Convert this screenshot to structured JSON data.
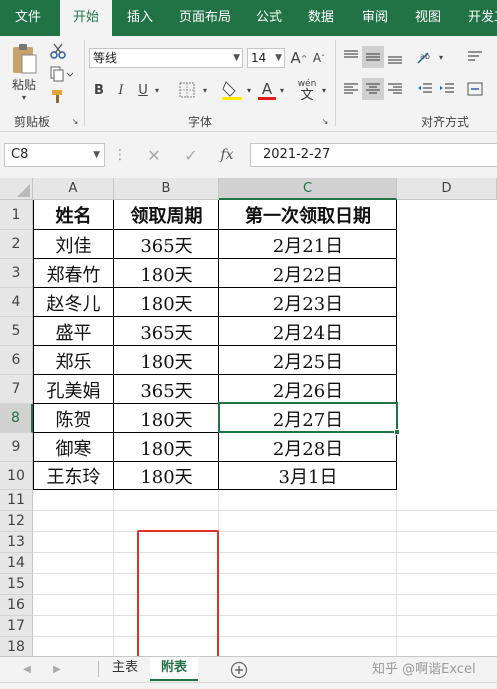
{
  "ribbon_tabs": [
    "文件",
    "开始",
    "插入",
    "页面布局",
    "公式",
    "数据",
    "审阅",
    "视图",
    "开发工具"
  ],
  "active_tab": "开始",
  "clipboard": {
    "paste_label": "粘贴",
    "group_label": "剪贴板"
  },
  "font": {
    "name": "等线",
    "size": "14",
    "grow": "A",
    "shrink": "A",
    "bold": "B",
    "italic": "I",
    "underline": "U",
    "font_color": "A",
    "phonetic": "wén",
    "group_label": "字体",
    "font_color_hex": "#e31b1b",
    "fill_color_hex": "#ffe600"
  },
  "alignment": {
    "group_label": "对齐方式"
  },
  "formula_bar": {
    "cell_ref": "C8",
    "fx": "fx",
    "value": "2021-2-27"
  },
  "grid": {
    "columns": [
      "A",
      "B",
      "C",
      "D"
    ],
    "selected_column": "C",
    "rows": [
      "1",
      "2",
      "3",
      "4",
      "5",
      "6",
      "7",
      "8",
      "9",
      "10",
      "11",
      "12",
      "13",
      "14",
      "15",
      "16",
      "17",
      "18"
    ],
    "selected_row": "8"
  },
  "table": {
    "headers": [
      "姓名",
      "领取周期",
      "第一次领取日期"
    ],
    "rows": [
      [
        "刘佳",
        "365天",
        "2月21日"
      ],
      [
        "郑春竹",
        "180天",
        "2月22日"
      ],
      [
        "赵冬儿",
        "180天",
        "2月23日"
      ],
      [
        "盛平",
        "365天",
        "2月24日"
      ],
      [
        "郑乐",
        "180天",
        "2月25日"
      ],
      [
        "孔美娟",
        "365天",
        "2月26日"
      ],
      [
        "陈贺",
        "180天",
        "2月27日"
      ],
      [
        "御寒",
        "180天",
        "2月28日"
      ],
      [
        "王东玲",
        "180天",
        "3月1日"
      ]
    ]
  },
  "sheet_tabs": [
    "主表",
    "附表"
  ],
  "active_sheet": "附表",
  "add_sheet": "+",
  "watermark": "知乎 @啊谐Excel",
  "colors": {
    "excel_green": "#217346",
    "highlight_red": "#e0302a"
  }
}
